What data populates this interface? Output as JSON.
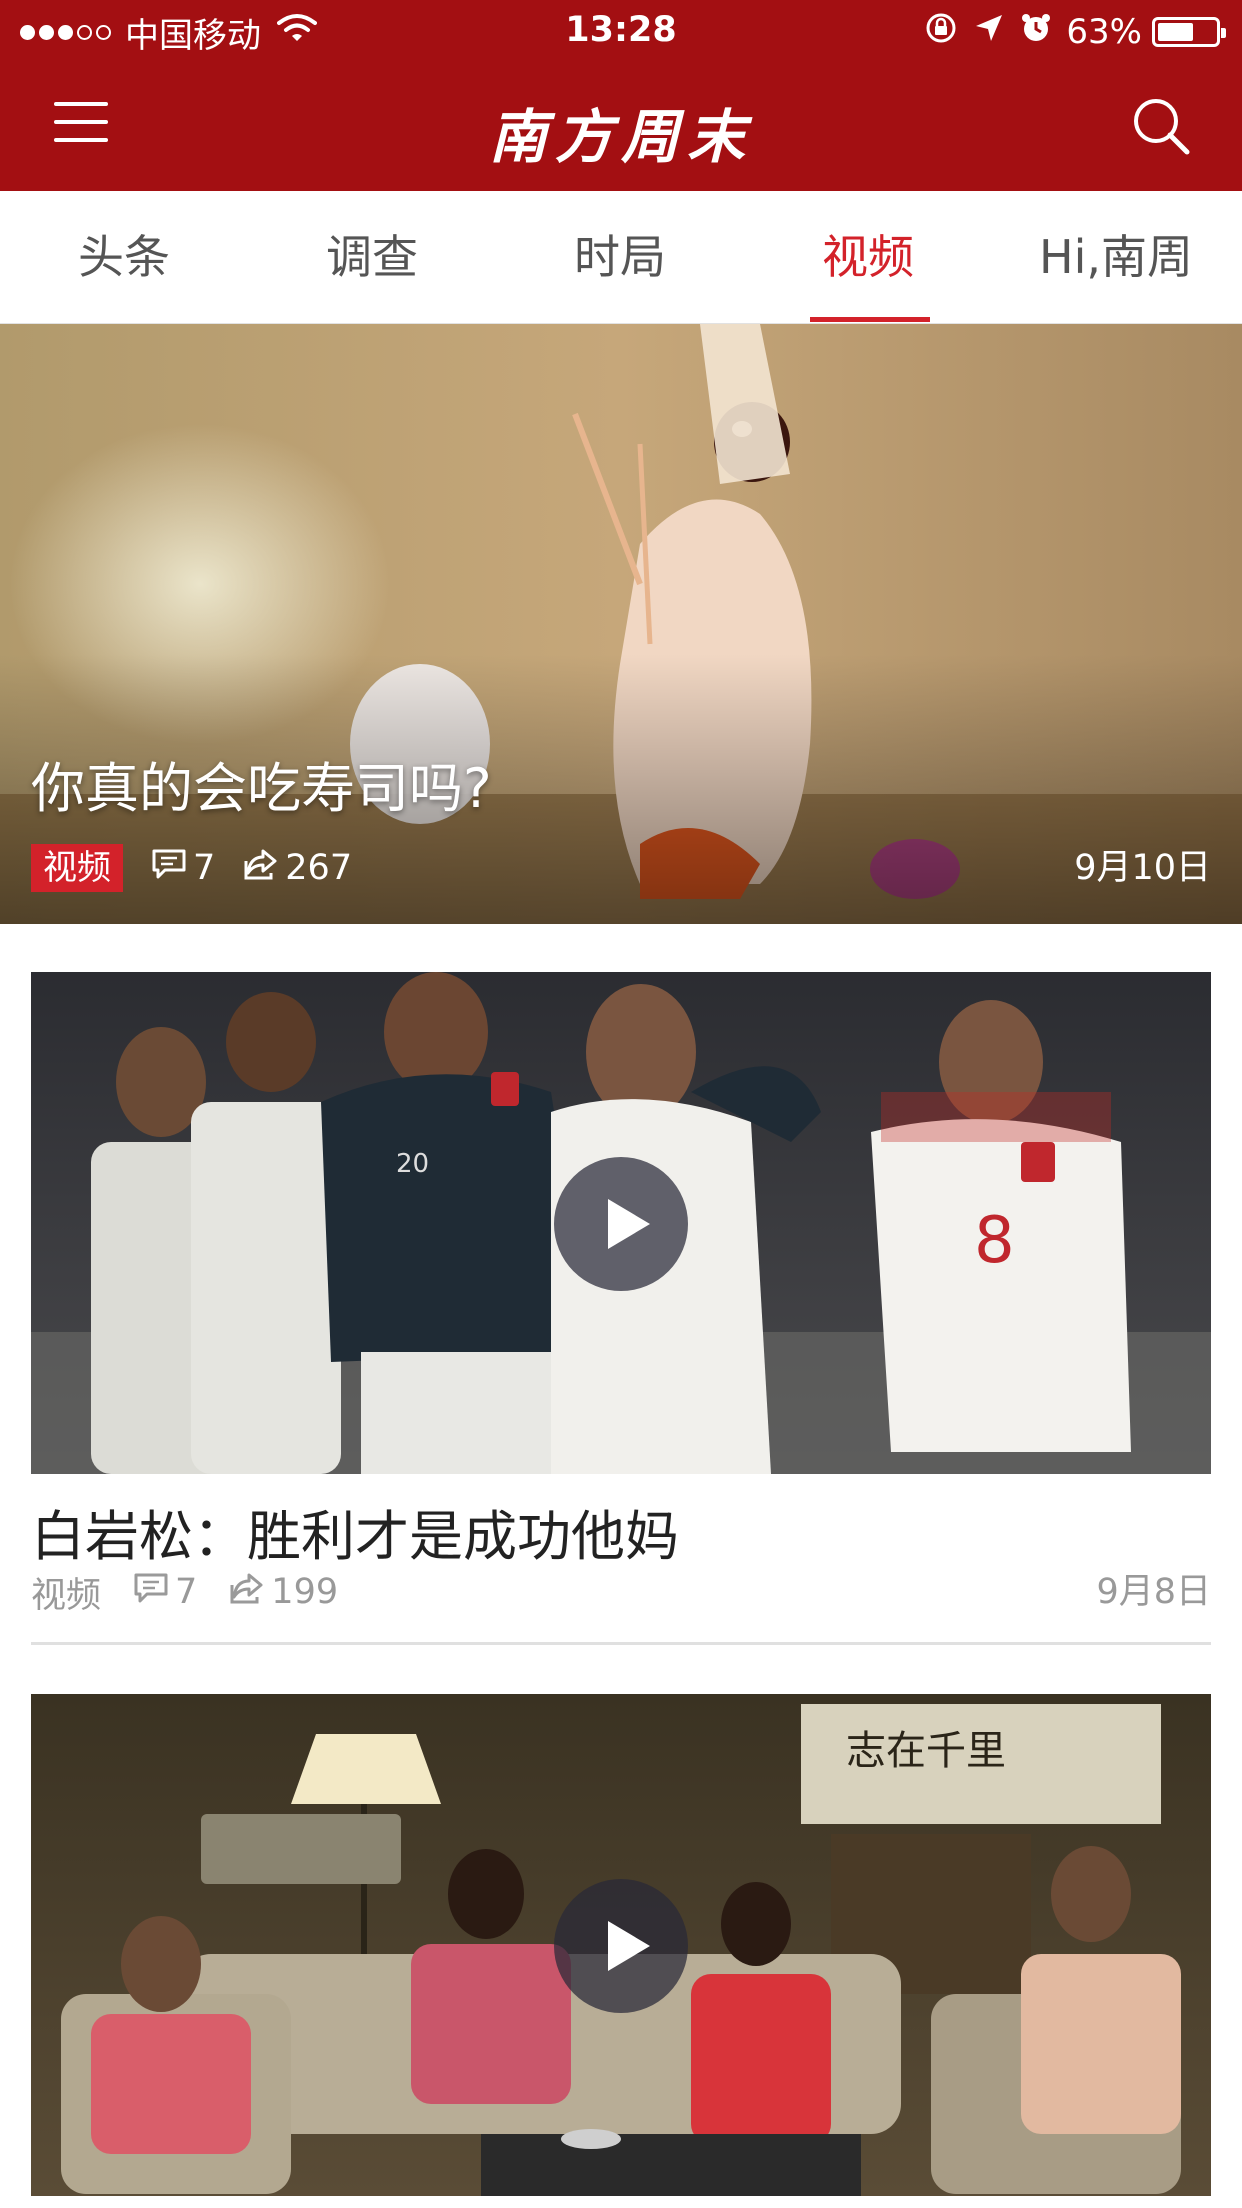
{
  "status_bar": {
    "carrier": "中国移动",
    "time": "13:28",
    "battery": "63%",
    "battery_level": 0.63,
    "signal_bars_filled": 3,
    "signal_bars_total": 5
  },
  "header": {
    "title": "南方周末",
    "menu_icon": "hamburger-menu-icon",
    "search_icon": "search-icon",
    "color": "#a30f12"
  },
  "tabs": [
    {
      "label": "头条"
    },
    {
      "label": "调查"
    },
    {
      "label": "时局"
    },
    {
      "label": "视频",
      "active": true
    },
    {
      "label": "Hi,南周"
    }
  ],
  "accent_color": "#d3222a",
  "hero": {
    "title": "你真的会吃寿司吗?",
    "tag": "视频",
    "comments": "7",
    "shares": "267",
    "date": "9月10日"
  },
  "articles": [
    {
      "title": "白岩松：胜利才是成功他妈",
      "category": "视频",
      "comments": "7",
      "shares": "199",
      "date": "9月8日"
    },
    {
      "title": "",
      "category": "",
      "comments": "",
      "shares": "",
      "date": ""
    }
  ],
  "icons": {
    "comment": "comment-bubble-icon",
    "share": "share-arrow-icon",
    "play": "play-icon"
  }
}
